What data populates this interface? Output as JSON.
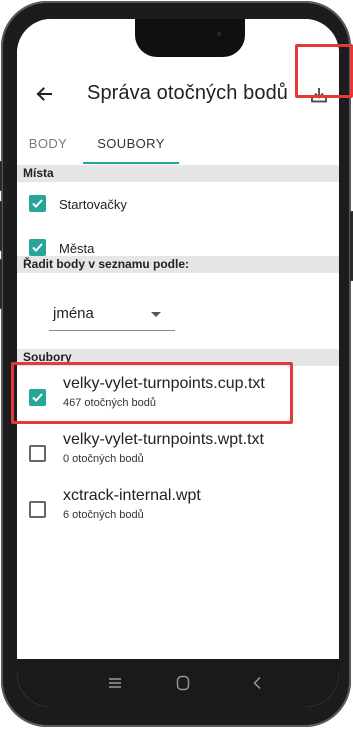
{
  "app_bar": {
    "title": "Správa otočných bodů",
    "back_icon": "arrow-left-icon",
    "download_icon": "download-icon"
  },
  "tabs": [
    {
      "label": "BODY",
      "selected": false
    },
    {
      "label": "SOUBORY",
      "selected": true
    }
  ],
  "places": {
    "header": "Místa",
    "items": [
      {
        "label": "Startovačky",
        "checked": true
      },
      {
        "label": "Města",
        "checked": true
      }
    ]
  },
  "sort": {
    "header": "Řadit body v seznamu podle:",
    "selected": "jména"
  },
  "files": {
    "header": "Soubory",
    "items": [
      {
        "name": "velky-vylet-turnpoints.cup.txt",
        "count": "467 otočných bodů",
        "checked": true
      },
      {
        "name": "velky-vylet-turnpoints.wpt.txt",
        "count": "0 otočných bodů",
        "checked": false
      },
      {
        "name": "xctrack-internal.wpt",
        "count": "6 otočných bodů",
        "checked": false
      }
    ]
  },
  "colors": {
    "accent": "#26a69a",
    "highlight": "#e53935",
    "section_bg": "#e6e6e6"
  },
  "nav_bar": {
    "icons": [
      "recents-icon",
      "home-icon",
      "back-icon"
    ]
  }
}
